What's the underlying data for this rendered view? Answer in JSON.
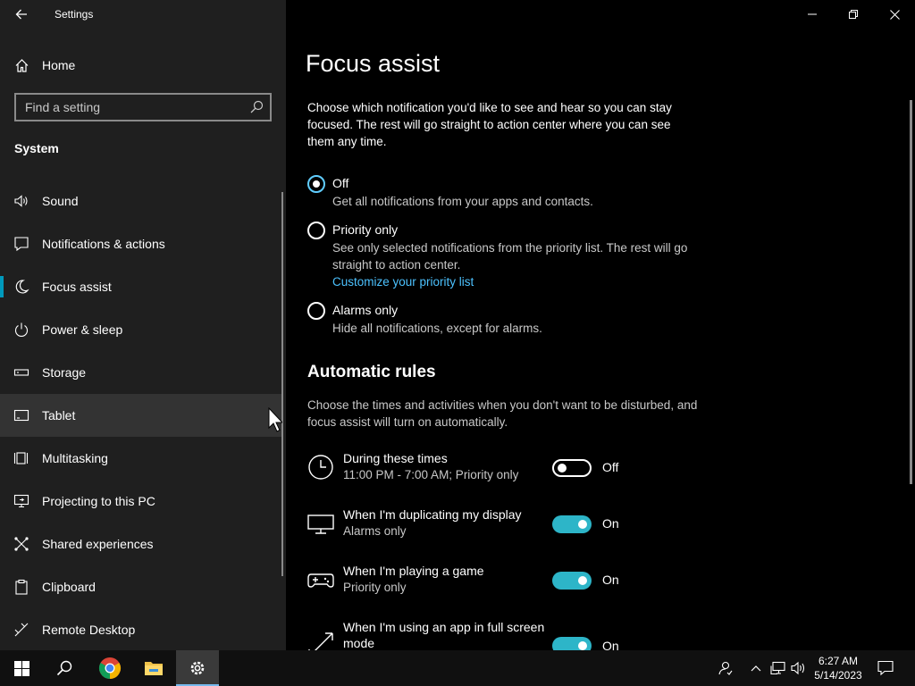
{
  "app": {
    "title": "Settings"
  },
  "sidebar": {
    "home_label": "Home",
    "search_placeholder": "Find a setting",
    "section_title": "System",
    "items": [
      {
        "label": "Sound",
        "icon": "speaker-icon"
      },
      {
        "label": "Notifications & actions",
        "icon": "notification-icon"
      },
      {
        "label": "Focus assist",
        "icon": "moon-icon",
        "selected": true
      },
      {
        "label": "Power & sleep",
        "icon": "power-icon"
      },
      {
        "label": "Storage",
        "icon": "storage-icon"
      },
      {
        "label": "Tablet",
        "icon": "tablet-icon",
        "hovered": true
      },
      {
        "label": "Multitasking",
        "icon": "multitasking-icon"
      },
      {
        "label": "Projecting to this PC",
        "icon": "projecting-icon"
      },
      {
        "label": "Shared experiences",
        "icon": "shared-experiences-icon"
      },
      {
        "label": "Clipboard",
        "icon": "clipboard-icon"
      },
      {
        "label": "Remote Desktop",
        "icon": "remote-desktop-icon"
      }
    ]
  },
  "main": {
    "title": "Focus assist",
    "description": "Choose which notification you'd like to see and hear so you can stay focused. The rest will go straight to action center where you can see them any time.",
    "options": [
      {
        "label": "Off",
        "description": "Get all notifications from your apps and contacts.",
        "checked": true
      },
      {
        "label": "Priority only",
        "description": "See only selected notifications from the priority list. The rest will go straight to action center.",
        "link": "Customize your priority list",
        "checked": false
      },
      {
        "label": "Alarms only",
        "description": "Hide all notifications, except for alarms.",
        "checked": false
      }
    ],
    "rules_title": "Automatic rules",
    "rules_description": "Choose the times and activities when you don't want to be disturbed, and focus assist will turn on automatically.",
    "rules": [
      {
        "title": "During these times",
        "subtitle": "11:00 PM - 7:00 AM; Priority only",
        "state": "Off",
        "on": false,
        "icon": "clock-icon"
      },
      {
        "title": "When I'm duplicating my display",
        "subtitle": "Alarms only",
        "state": "On",
        "on": true,
        "icon": "monitor-icon"
      },
      {
        "title": "When I'm playing a game",
        "subtitle": "Priority only",
        "state": "On",
        "on": true,
        "icon": "gamepad-icon"
      },
      {
        "title": "When I'm using an app in full screen mode",
        "subtitle": "",
        "state": "On",
        "on": true,
        "icon": "fullscreen-icon"
      }
    ]
  },
  "taskbar": {
    "time": "6:27 AM",
    "date": "5/14/2023",
    "apps": [
      "windows-start-icon",
      "search-icon",
      "chrome-icon",
      "file-explorer-icon",
      "settings-gear-icon"
    ]
  },
  "colors": {
    "accent": "#0099bc",
    "toggle_on": "#2db5c8",
    "link": "#4cc2ff"
  }
}
